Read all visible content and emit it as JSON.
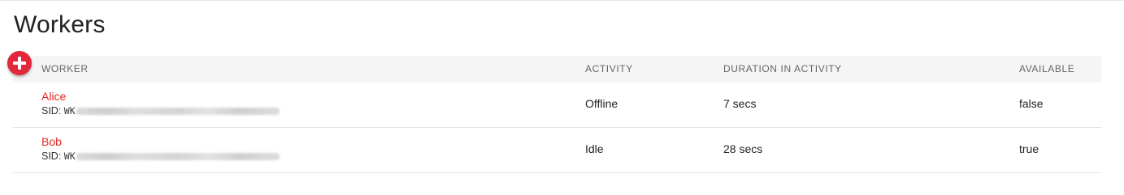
{
  "page": {
    "title": "Workers"
  },
  "table": {
    "headers": {
      "worker": "WORKER",
      "activity": "ACTIVITY",
      "duration": "DURATION IN ACTIVITY",
      "available": "AVAILABLE"
    },
    "rows": [
      {
        "name": "Alice",
        "sid_label": "SID: ",
        "sid_prefix": "WK",
        "activity": "Offline",
        "duration": "7 secs",
        "available": "false"
      },
      {
        "name": "Bob",
        "sid_label": "SID: ",
        "sid_prefix": "WK",
        "activity": "Idle",
        "duration": "28 secs",
        "available": "true"
      }
    ]
  },
  "add_button": {
    "icon": "plus-icon",
    "color": "#e3283b"
  },
  "colors": {
    "worker_link": "#e2261f",
    "header_bg": "#f5f5f5"
  }
}
